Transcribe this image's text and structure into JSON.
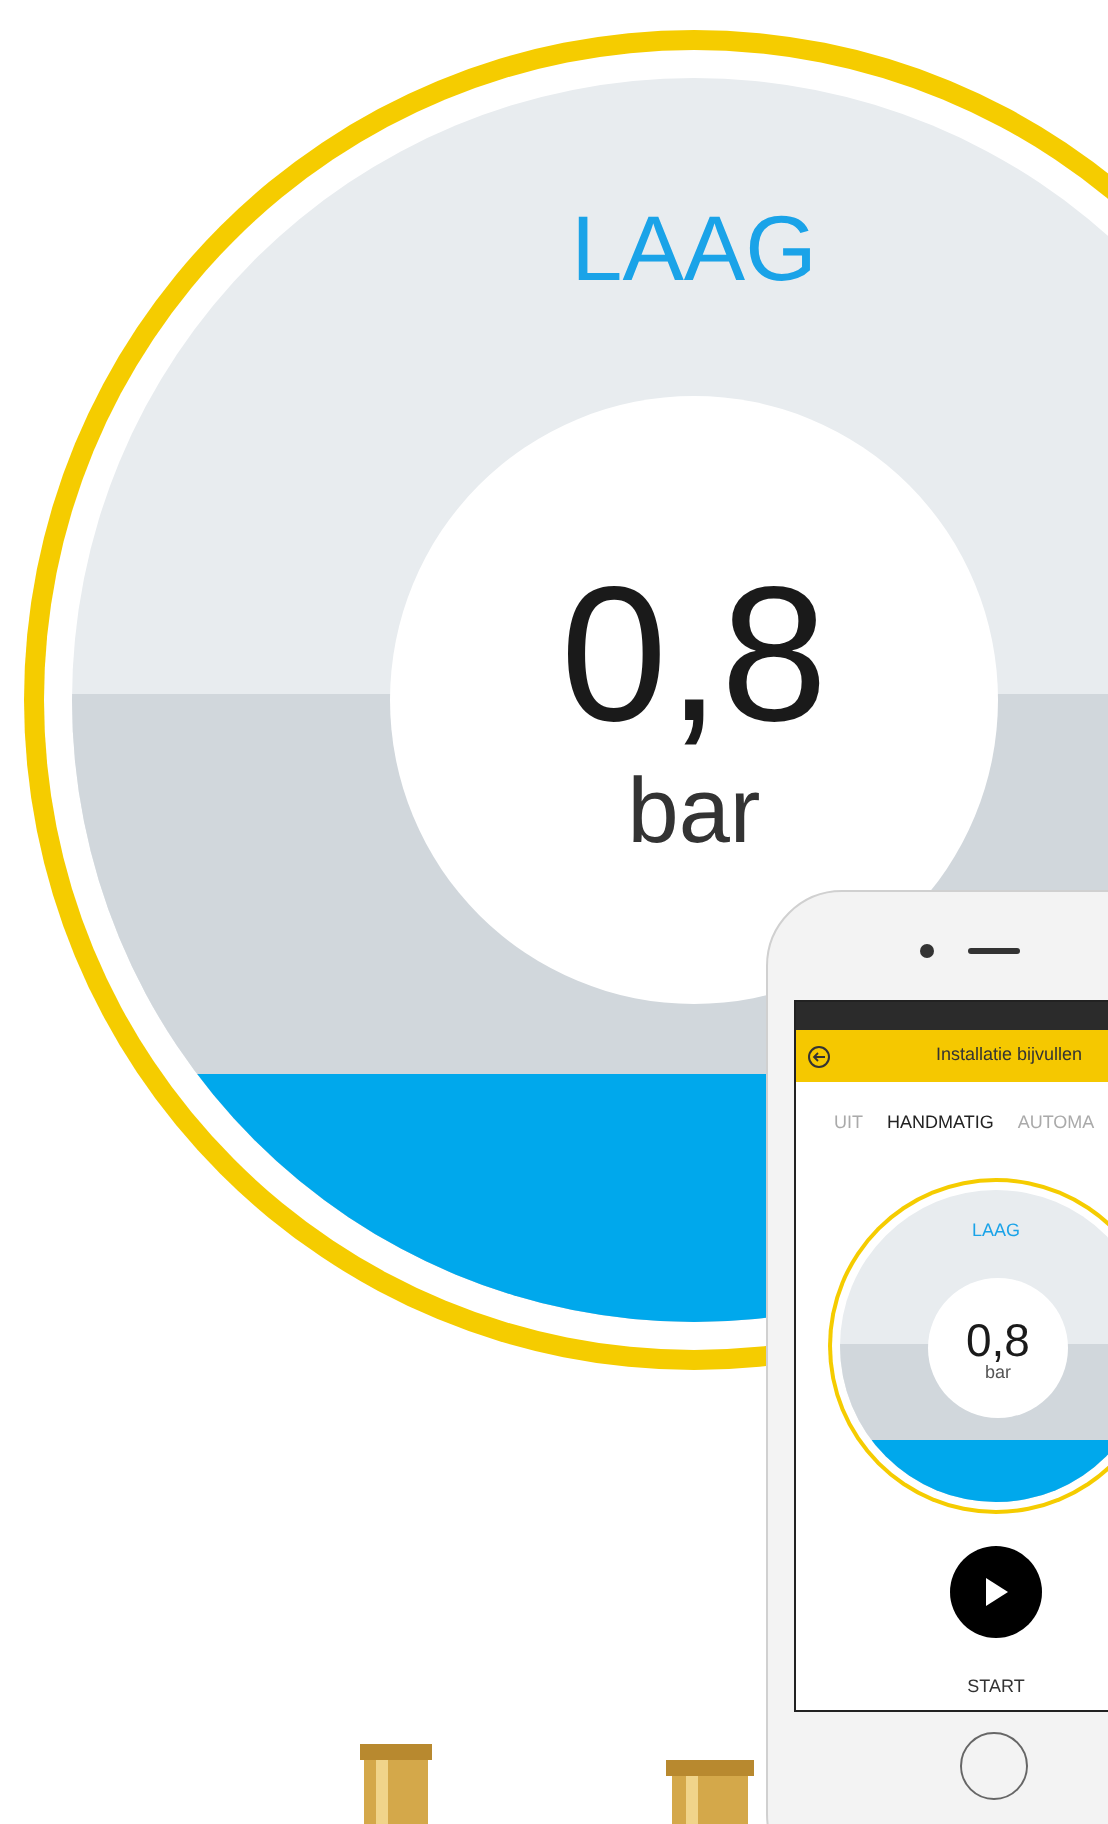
{
  "gauge": {
    "status": "LAAG",
    "value": "0,8",
    "unit": "bar"
  },
  "phone": {
    "header": {
      "title": "Installatie bijvullen"
    },
    "tabs": [
      {
        "label": "UIT",
        "selected": false
      },
      {
        "label": "HANDMATIG",
        "selected": true
      },
      {
        "label": "AUTOMA",
        "selected": false
      }
    ],
    "gauge": {
      "status": "LAAG",
      "value": "0,8",
      "unit": "bar"
    },
    "start_button": {
      "label": "START"
    }
  }
}
